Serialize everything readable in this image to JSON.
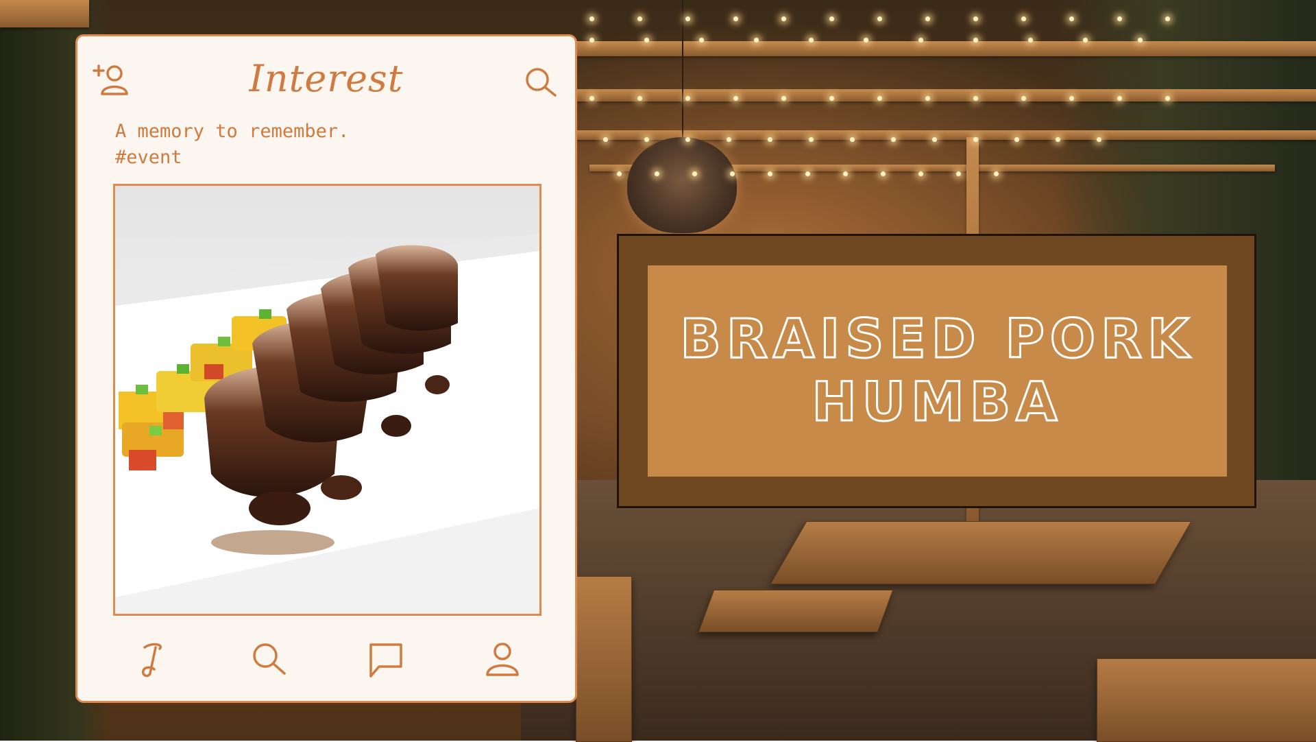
{
  "post": {
    "app_title": "Interest",
    "caption_line1": "A memory to remember.",
    "caption_line2": "#event"
  },
  "icons": {
    "add_user": "add-user-icon",
    "search_top": "search-icon",
    "nav_home": "interest-logo-icon",
    "nav_search": "search-icon",
    "nav_messages": "chat-icon",
    "nav_profile": "profile-icon"
  },
  "title_card": {
    "line1": "BRAISED PORK",
    "line2": "HUMBA"
  },
  "colors": {
    "accent": "#d07a40",
    "card_bg": "#fcf6f1",
    "panel_outer": "#6f4720",
    "panel_inner": "#c88a48",
    "title_text": "#ffffff"
  }
}
